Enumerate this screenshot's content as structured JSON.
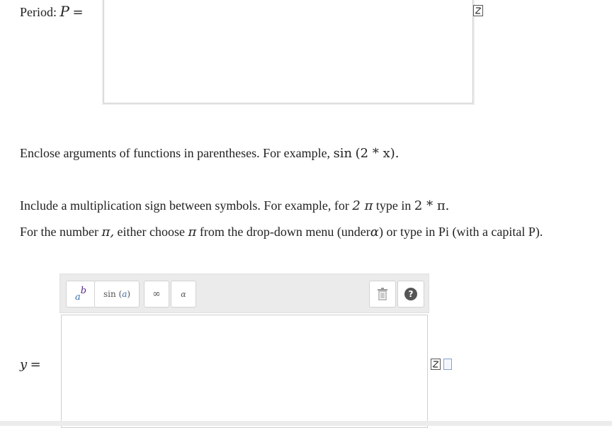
{
  "period": {
    "label": "Period:",
    "var": "P",
    "eq": "="
  },
  "instructions": {
    "line1_text": "Enclose arguments of functions in parentheses. For example,",
    "line1_func": "sin",
    "line1_expr": "(2 * x).",
    "line2_text": "Include a multiplication sign between symbols. For example, for",
    "line2_expr": "2 π",
    "line2_mid": "type in",
    "line2_expr2": "2 * π.",
    "line3_a": "For the number",
    "line3_pi": "π,",
    "line3_b": "either choose",
    "line3_pi2": "π",
    "line3_c": "from the drop-down menu (under",
    "line3_alpha": "α",
    "line3_d": ") or type in Pi (with a capital P)."
  },
  "toolbar": {
    "buttons": [
      {
        "label": "ab",
        "icon": "superscript-icon"
      },
      {
        "label": "sin (a)",
        "icon": "function-icon"
      },
      {
        "label": "∞",
        "icon": "infinity-icon"
      },
      {
        "label": "α",
        "icon": "greek-letter-icon"
      }
    ],
    "trash_icon": "trash-icon",
    "help_icon": "help-icon",
    "help_glyph": "?"
  },
  "answer": {
    "var": "y",
    "eq": "="
  },
  "colors": {
    "toolbar_bg": "#ebebeb",
    "superscript_a": "#3a6fb0",
    "superscript_b": "#5b2a86",
    "help_bg": "#555555"
  }
}
